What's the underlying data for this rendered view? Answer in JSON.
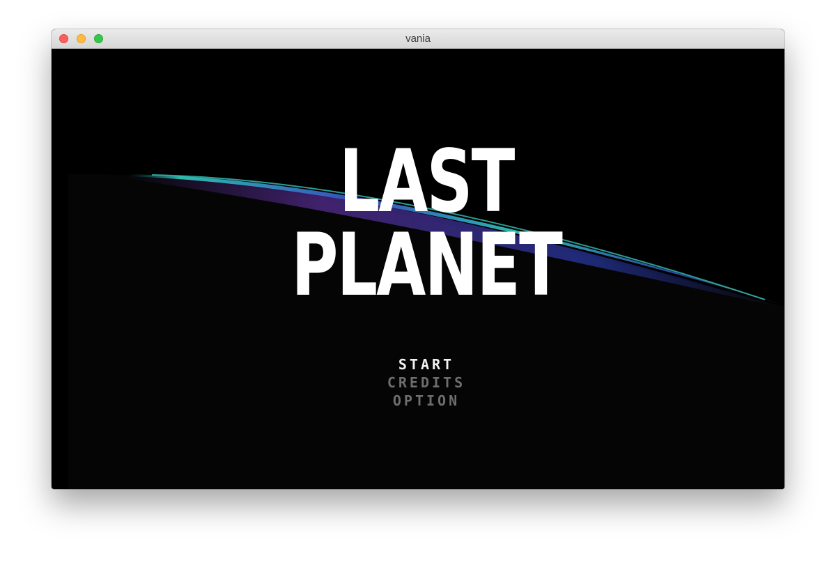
{
  "window": {
    "title": "vania"
  },
  "game": {
    "logo": {
      "line1": "LAST",
      "line2": "PLANET"
    },
    "menu": {
      "items": [
        {
          "label": "START",
          "selected": true
        },
        {
          "label": "CREDITS",
          "selected": false
        },
        {
          "label": "OPTION",
          "selected": false
        }
      ]
    }
  },
  "colors": {
    "background": "#000000",
    "logo": "#ffffff",
    "menu_selected": "#f2f2f2",
    "menu_unselected": "#6e6e6e",
    "planet_rim_cyan": "#2fd0c0",
    "planet_rim_blue": "#3b4fc8",
    "planet_rim_purple": "#5a2f9a"
  }
}
